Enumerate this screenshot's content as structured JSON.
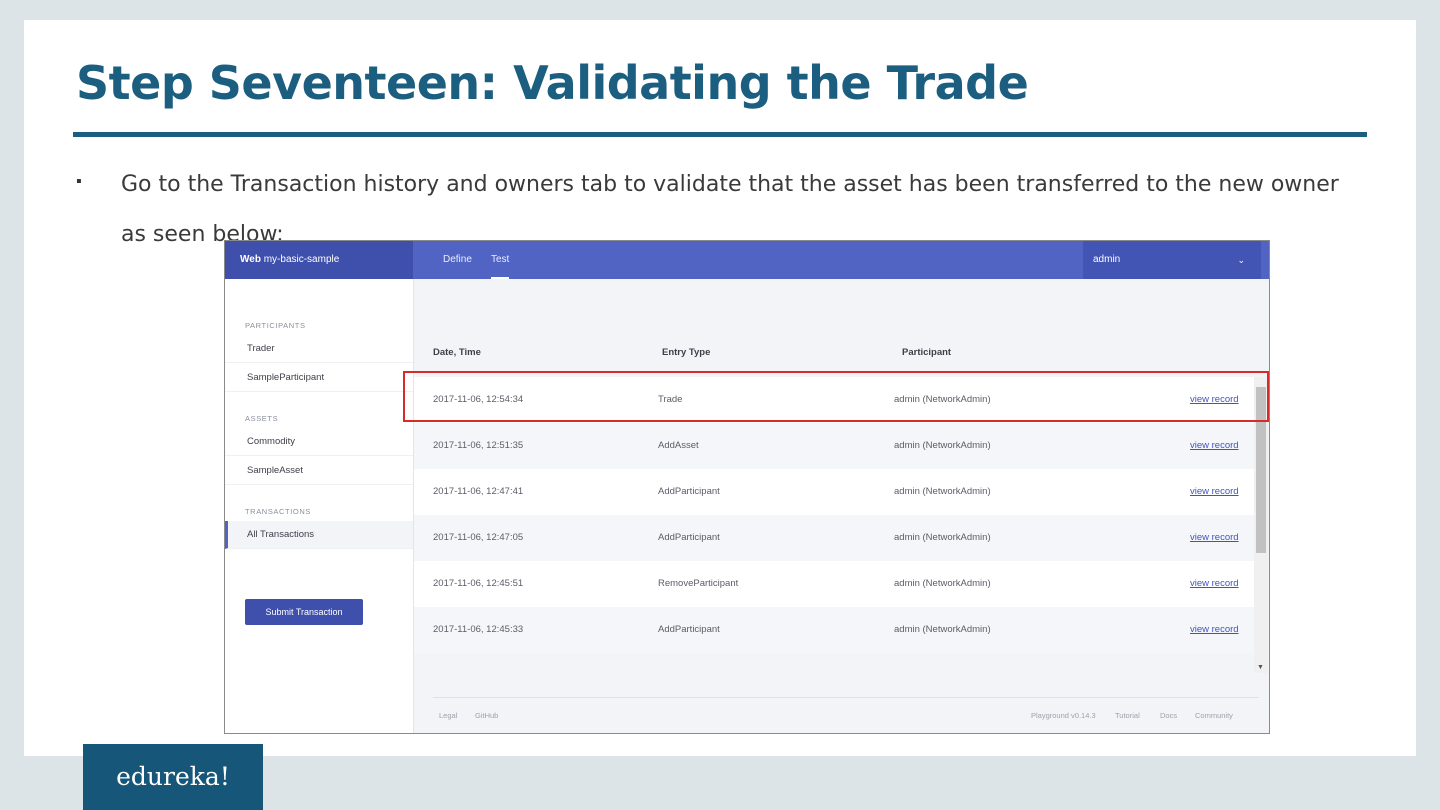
{
  "slide": {
    "title": "Step Seventeen: Validating the Trade",
    "bullet_marker": "▪",
    "bullet_text": "Go to the Transaction history and owners tab to validate that the asset has been transferred to the new owner as seen below:",
    "logo_text": "edureka!"
  },
  "app": {
    "brand_bold": "Web",
    "brand_name": "my-basic-sample",
    "tabs": [
      {
        "label": "Define",
        "active": false
      },
      {
        "label": "Test",
        "active": true
      }
    ],
    "user": "admin",
    "sidebar": {
      "participants_heading": "PARTICIPANTS",
      "participants": [
        "Trader",
        "SampleParticipant"
      ],
      "assets_heading": "ASSETS",
      "assets": [
        "Commodity",
        "SampleAsset"
      ],
      "transactions_heading": "TRANSACTIONS",
      "transactions": [
        "All Transactions"
      ],
      "submit_label": "Submit Transaction"
    },
    "table": {
      "columns": [
        "Date, Time",
        "Entry Type",
        "Participant"
      ],
      "rows": [
        {
          "datetime": "2017-11-06, 12:54:34",
          "entry_type": "Trade",
          "participant": "admin (NetworkAdmin)",
          "link": "view record"
        },
        {
          "datetime": "2017-11-06, 12:51:35",
          "entry_type": "AddAsset",
          "participant": "admin (NetworkAdmin)",
          "link": "view record"
        },
        {
          "datetime": "2017-11-06, 12:47:41",
          "entry_type": "AddParticipant",
          "participant": "admin (NetworkAdmin)",
          "link": "view record"
        },
        {
          "datetime": "2017-11-06, 12:47:05",
          "entry_type": "AddParticipant",
          "participant": "admin (NetworkAdmin)",
          "link": "view record"
        },
        {
          "datetime": "2017-11-06, 12:45:51",
          "entry_type": "RemoveParticipant",
          "participant": "admin (NetworkAdmin)",
          "link": "view record"
        },
        {
          "datetime": "2017-11-06, 12:45:33",
          "entry_type": "AddParticipant",
          "participant": "admin (NetworkAdmin)",
          "link": "view record"
        }
      ]
    },
    "footer": {
      "left": [
        "Legal",
        "GitHub"
      ],
      "right": [
        "Playground v0.14.3",
        "Tutorial",
        "Docs",
        "Community"
      ]
    }
  },
  "colors": {
    "title": "#1b5e80",
    "app_header": "#5164c3",
    "highlight": "#d82a2a",
    "logo_bg": "#165679"
  }
}
